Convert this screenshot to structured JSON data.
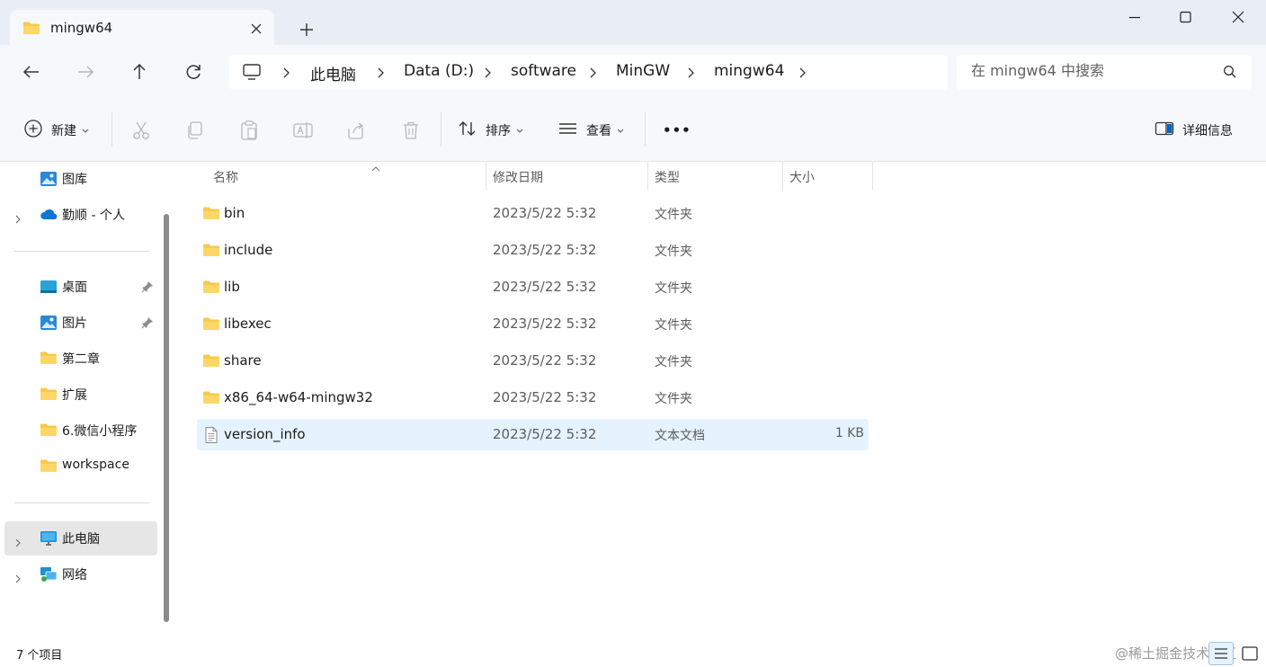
{
  "window": {
    "tab_title": "mingw64",
    "icons": {
      "minimize": "minimize-icon",
      "maximize": "maximize-icon",
      "close": "close-icon",
      "new_tab": "plus-icon",
      "tab_close": "close-icon"
    }
  },
  "address": {
    "breadcrumbs": [
      "此电脑",
      "Data (D:)",
      "software",
      "MinGW",
      "mingw64"
    ],
    "search_placeholder": "在 mingw64 中搜索"
  },
  "toolbar": {
    "new_label": "新建",
    "sort_label": "排序",
    "view_label": "查看",
    "more_label": "•••",
    "details_label": "详细信息",
    "disabled_icons": [
      "cut-icon",
      "copy-icon",
      "paste-icon",
      "rename-icon",
      "share-icon",
      "delete-icon"
    ]
  },
  "sidebar": {
    "items": [
      {
        "label": "图库",
        "icon": "gallery-icon"
      },
      {
        "label": "勤顺 - 个人",
        "icon": "onedrive-icon",
        "expandable": true
      },
      {
        "label": "桌面",
        "icon": "desktop-icon",
        "pinned": true
      },
      {
        "label": "图片",
        "icon": "pictures-icon",
        "pinned": true
      },
      {
        "label": "第二章",
        "icon": "folder-icon"
      },
      {
        "label": "扩展",
        "icon": "folder-icon"
      },
      {
        "label": "6.微信小程序",
        "icon": "folder-icon"
      },
      {
        "label": "workspace",
        "icon": "folder-icon"
      },
      {
        "label": "此电脑",
        "icon": "pc-icon",
        "expandable": true,
        "selected": true
      },
      {
        "label": "网络",
        "icon": "network-icon",
        "expandable": true
      }
    ]
  },
  "file_list": {
    "columns": [
      "名称",
      "修改日期",
      "类型",
      "大小"
    ],
    "rows": [
      {
        "name": "bin",
        "date": "2023/5/22 5:32",
        "type": "文件夹",
        "size": "",
        "icon": "folder-icon"
      },
      {
        "name": "include",
        "date": "2023/5/22 5:32",
        "type": "文件夹",
        "size": "",
        "icon": "folder-icon"
      },
      {
        "name": "lib",
        "date": "2023/5/22 5:32",
        "type": "文件夹",
        "size": "",
        "icon": "folder-icon"
      },
      {
        "name": "libexec",
        "date": "2023/5/22 5:32",
        "type": "文件夹",
        "size": "",
        "icon": "folder-icon"
      },
      {
        "name": "share",
        "date": "2023/5/22 5:32",
        "type": "文件夹",
        "size": "",
        "icon": "folder-icon"
      },
      {
        "name": "x86_64-w64-mingw32",
        "date": "2023/5/22 5:32",
        "type": "文件夹",
        "size": "",
        "icon": "folder-icon"
      },
      {
        "name": "version_info",
        "date": "2023/5/22 5:32",
        "type": "文本文档",
        "size": "1 KB",
        "icon": "text-file-icon",
        "selected": true
      }
    ]
  },
  "status": {
    "item_count": "7 个项目",
    "watermark": "@稀土掘金技术社区"
  },
  "colors": {
    "tabbar_bg": "#e9eef6",
    "chrome_bg": "#f6f8fc",
    "selection_bg": "#e5f3ff",
    "folder_yellow": "#f8c94a",
    "accent_blue": "#0067c0"
  }
}
